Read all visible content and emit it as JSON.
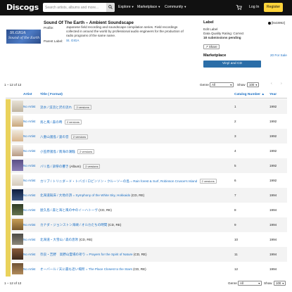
{
  "header": {
    "logo": "Discogs",
    "search_placeholder": "Search artists, albums and more...",
    "nav": [
      "Explore",
      "Marketplace",
      "Community"
    ],
    "login": "Log In",
    "register": "Register"
  },
  "release": {
    "title": "Sound Of The Earth – Ambient Soundscape",
    "profile_label": "Profile:",
    "profile_text": "Japanese field recording and soundscape compilation series. Field recordings collected in around the world by professional audio engineers for the production of radio programs of the same name.",
    "parent_label_label": "Parent Label:",
    "parent_label": "St. GIGA",
    "cover_line1": "St.GIGA",
    "cover_line2": "Sound of the Earth"
  },
  "sidebar": {
    "label_heading": "Label",
    "release_id": "[l643992]",
    "edit_label": "Edit Label",
    "data_quality": "Data Quality Rating: Correct",
    "submissions": "18 submissions pending",
    "share": "Share",
    "marketplace_heading": "Marketplace",
    "for_sale": "20 For Sale",
    "vinyl_cd_button": "Vinyl and CD"
  },
  "pagination": {
    "count": "1 – 12 of 12",
    "genre_label": "Genre",
    "genre_value": "All",
    "show_label": "Show",
    "show_value": "100"
  },
  "table": {
    "headers": {
      "artist": "Artist",
      "title": "Title ( Format)",
      "catalog": "Catalog Number ▲",
      "year": "Year"
    },
    "rows": [
      {
        "artist": "No Artist",
        "title": "流水 / 渓流と沢の流れ",
        "format": "",
        "versions": "2 versions",
        "num": "1",
        "year": "1992"
      },
      {
        "artist": "No Artist",
        "title": "鳥と風 / 森の時",
        "format": "",
        "versions": "2 versions",
        "num": "2",
        "year": "1992"
      },
      {
        "artist": "No Artist",
        "title": "八重山諸島 / 波の音",
        "format": "",
        "versions": "2 versions",
        "num": "3",
        "year": "1992"
      },
      {
        "artist": "No Artist",
        "title": "小笠原諸島 / 南海の潮騒",
        "format": "",
        "versions": "2 versions",
        "num": "4",
        "year": "1992"
      },
      {
        "artist": "No Artist",
        "title": "バリ島 / 諦祭の響き",
        "format": "(Album)",
        "versions": "2 versions",
        "num": "5",
        "year": "1992"
      },
      {
        "artist": "No Artist",
        "title": "カリブ / トリニダード・トバゴ / ロビンソン・クルーソーの島 = Rain forest & Surf, Robinson Crusoe's Island",
        "format": "",
        "versions": "2 versions",
        "num": "6",
        "year": "1992"
      },
      {
        "artist": "No Artist",
        "title": "北海道知床 / 大地の詩 = Symphony of the White Sky, Hokkaido",
        "format": "(CD, RE)",
        "versions": "",
        "num": "7",
        "year": "1994"
      },
      {
        "artist": "No Artist",
        "title": "屋久島 / 森と海と風の中のイーハトーヴ",
        "format": "(CD, RE)",
        "versions": "",
        "num": "8",
        "year": "1994"
      },
      {
        "artist": "No Artist",
        "title": "カナダ・ジョンストン海峡 / オルカたちの時間",
        "format": "(CD, RE)",
        "versions": "",
        "num": "9",
        "year": "1994"
      },
      {
        "artist": "No Artist",
        "title": "北海道・大雪山 / 森の息吹",
        "format": "(CD, RE)",
        "versions": "",
        "num": "10",
        "year": "1994"
      },
      {
        "artist": "No Artist",
        "title": "奈良・吉野　高野山霊場の祈り = Prayers for the Spirit of Nature",
        "format": "(CD, RE)",
        "versions": "",
        "num": "11",
        "year": "1994"
      },
      {
        "artist": "No Artist",
        "title": "オーバール / 天に最も近い場所 = The Place Closest to the Stars",
        "format": "(CD, RE)",
        "versions": "",
        "num": "12",
        "year": "1994"
      }
    ]
  },
  "colors": {
    "topbar": "#111111",
    "register": "#ffd43b",
    "link": "#1a6fc4",
    "button": "#2b6ea8",
    "stripe": "#ead25b"
  }
}
